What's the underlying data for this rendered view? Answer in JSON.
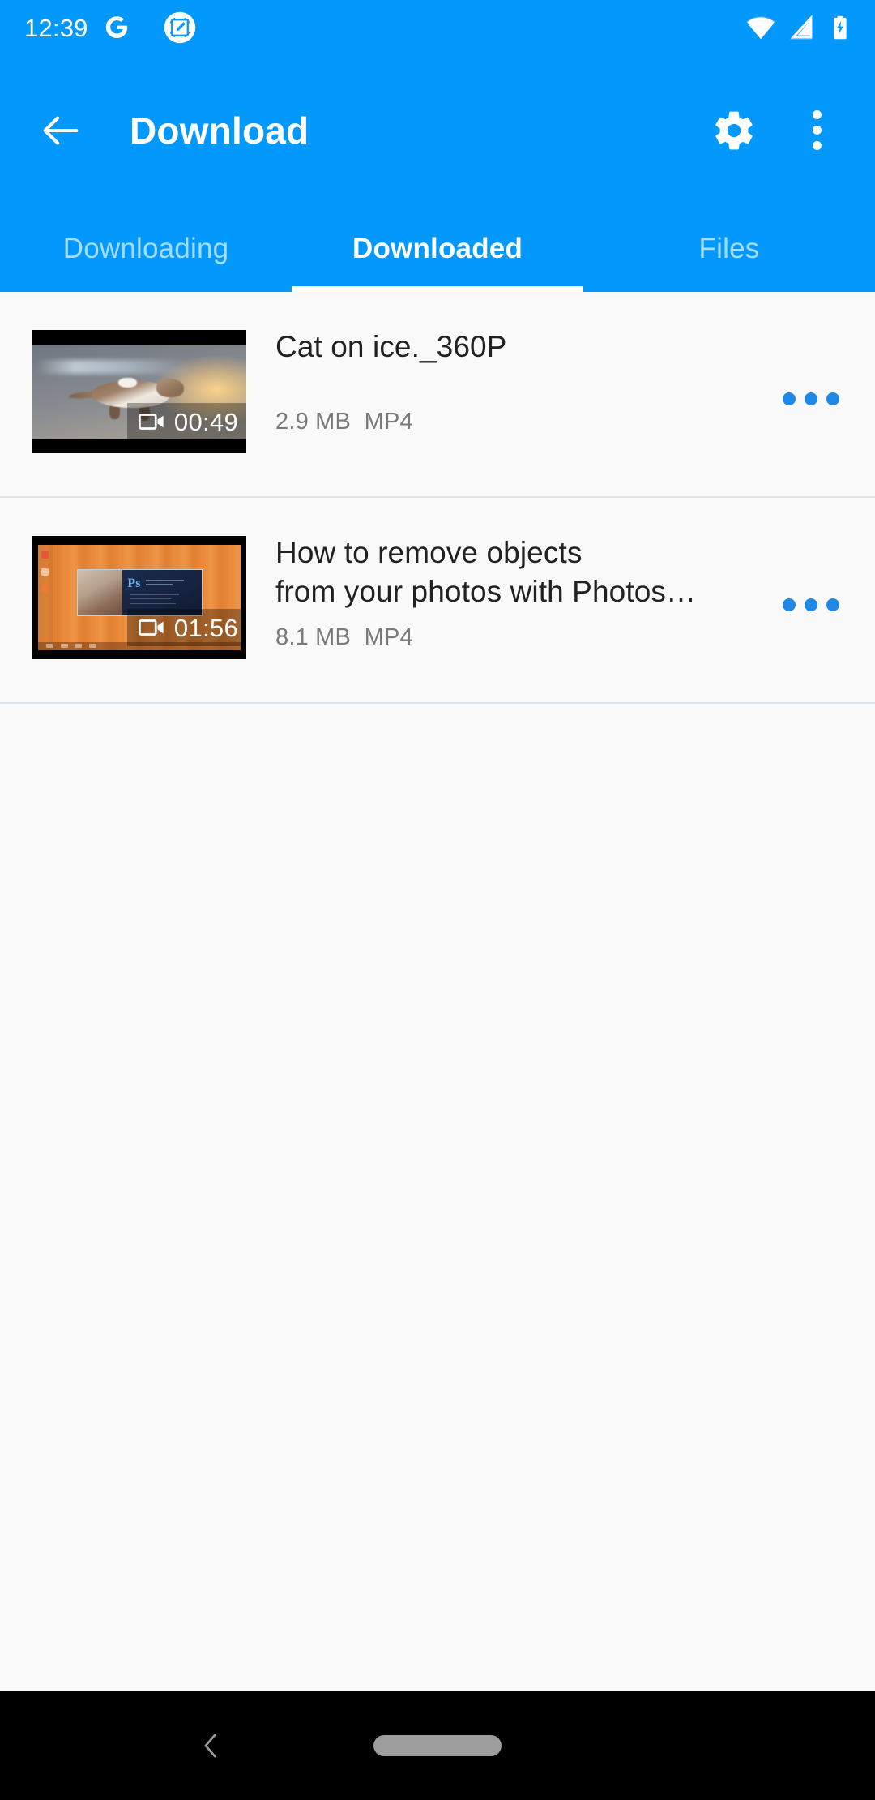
{
  "status_bar": {
    "time": "12:39",
    "icons": [
      "google-g-icon",
      "screenshot-markup-icon",
      "wifi-icon",
      "cellular-signal-icon",
      "battery-charging-icon"
    ],
    "background_color": "#0398FB"
  },
  "app_bar": {
    "back_label": "Back",
    "title": "Download",
    "settings_label": "Settings",
    "overflow_label": "More options",
    "background_color": "#0398FB",
    "title_color": "#FFFFFF"
  },
  "tabs": {
    "items": [
      {
        "label": "Downloading",
        "active": false
      },
      {
        "label": "Downloaded",
        "active": true
      },
      {
        "label": "Files",
        "active": false
      }
    ],
    "active_index": 1,
    "active_color": "#FFFFFF",
    "inactive_color": "#A6DCFD",
    "indicator_color": "#FFFFFF"
  },
  "content": {
    "background_color": "#F9F9F9",
    "divider_color": "#DCE6EC",
    "items": [
      {
        "title": "Cat on ice._360P",
        "size": "2.9 MB",
        "format": "MP4",
        "duration": "00:49",
        "thumbnail": "cat-on-ice-video-thumbnail",
        "more_label": "More actions"
      },
      {
        "title": "How to remove objects\nfrom your photos with Photos…",
        "size": "8.1 MB",
        "format": "MP4",
        "duration": "01:56",
        "thumbnail": "photoshop-tutorial-video-thumbnail",
        "more_label": "More actions"
      }
    ],
    "title_color": "#212121",
    "meta_color": "#7A7A7A",
    "more_dots_color": "#1E88E5"
  },
  "nav_bar": {
    "back_label": "Back",
    "home_pill_label": "Home",
    "background_color": "#000000",
    "pill_color": "#9E9E9E"
  }
}
